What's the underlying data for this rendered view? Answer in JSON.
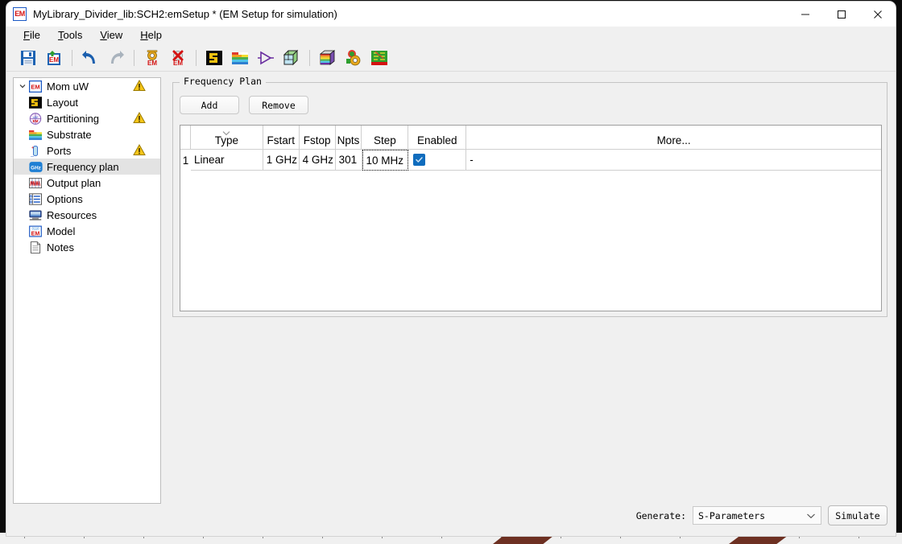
{
  "window": {
    "title": "MyLibrary_Divider_lib:SCH2:emSetup * (EM Setup for simulation)",
    "app_icon_text": "EM",
    "controls": {
      "minimize": "minimize-icon",
      "maximize": "maximize-icon",
      "close": "close-icon"
    }
  },
  "menubar": {
    "items": [
      {
        "label": "File",
        "accel": "F"
      },
      {
        "label": "Tools",
        "accel": "T"
      },
      {
        "label": "View",
        "accel": "V"
      },
      {
        "label": "Help",
        "accel": "H"
      }
    ]
  },
  "toolbar": {
    "buttons": [
      {
        "icon": "save-icon",
        "tooltip": "Save"
      },
      {
        "icon": "save-em-setup-icon",
        "tooltip": "Save EM Setup"
      },
      {
        "icon": "undo-icon",
        "tooltip": "Undo"
      },
      {
        "icon": "redo-icon",
        "tooltip": "Redo"
      },
      {
        "icon": "em-settings-icon",
        "tooltip": "EM Settings"
      },
      {
        "icon": "em-delete-icon",
        "tooltip": "Delete EM Setup"
      },
      {
        "icon": "layout-icon",
        "tooltip": "Layout"
      },
      {
        "icon": "substrate-icon",
        "tooltip": "Substrate"
      },
      {
        "icon": "symbol-icon",
        "tooltip": "Symbol"
      },
      {
        "icon": "3d-view-icon",
        "tooltip": "3D View"
      },
      {
        "icon": "3d-em-preview-icon",
        "tooltip": "3D EM Preview"
      },
      {
        "icon": "em-cosim-icon",
        "tooltip": "EM Cosimulation"
      },
      {
        "icon": "em-model-icon",
        "tooltip": "EM Model"
      }
    ]
  },
  "tree": {
    "root": {
      "label": "Mom uW",
      "icon": "em-icon",
      "expanded": true,
      "warning": true
    },
    "items": [
      {
        "label": "Layout",
        "icon": "layout-icon",
        "warning": false,
        "selected": false
      },
      {
        "label": "Partitioning",
        "icon": "partitioning-icon",
        "warning": true,
        "selected": false
      },
      {
        "label": "Substrate",
        "icon": "substrate-icon",
        "warning": false,
        "selected": false
      },
      {
        "label": "Ports",
        "icon": "ports-icon",
        "warning": true,
        "selected": false
      },
      {
        "label": "Frequency plan",
        "icon": "ghz-icon",
        "warning": false,
        "selected": true
      },
      {
        "label": "Output plan",
        "icon": "output-plan-icon",
        "warning": false,
        "selected": false
      },
      {
        "label": "Options",
        "icon": "options-icon",
        "warning": false,
        "selected": false
      },
      {
        "label": "Resources",
        "icon": "resources-icon",
        "warning": false,
        "selected": false
      },
      {
        "label": "Model",
        "icon": "model-icon",
        "warning": false,
        "selected": false
      },
      {
        "label": "Notes",
        "icon": "notes-icon",
        "warning": false,
        "selected": false
      }
    ]
  },
  "frequency_plan": {
    "group_title": "Frequency Plan",
    "add_label": "Add",
    "remove_label": "Remove",
    "columns": [
      {
        "key": "num",
        "label": ""
      },
      {
        "key": "type",
        "label": "Type",
        "sorted": true
      },
      {
        "key": "fstart",
        "label": "Fstart"
      },
      {
        "key": "fstop",
        "label": "Fstop"
      },
      {
        "key": "npts",
        "label": "Npts"
      },
      {
        "key": "step",
        "label": "Step"
      },
      {
        "key": "enabled",
        "label": "Enabled"
      },
      {
        "key": "more",
        "label": "More..."
      }
    ],
    "rows": [
      {
        "num": "1",
        "type": "Linear",
        "fstart": "1 GHz",
        "fstop": "4 GHz",
        "npts": "301",
        "step": "10 MHz",
        "enabled": true,
        "more": "-"
      }
    ]
  },
  "footer": {
    "generate_label": "Generate:",
    "generate_value": "S-Parameters",
    "generate_options": [
      "S-Parameters"
    ],
    "simulate_label": "Simulate"
  },
  "colors": {
    "accent_blue": "#0f6cbd",
    "warning_yellow": "#f5c518",
    "selection_gray": "#e3e3e3",
    "window_bg": "#f0f0f0"
  }
}
